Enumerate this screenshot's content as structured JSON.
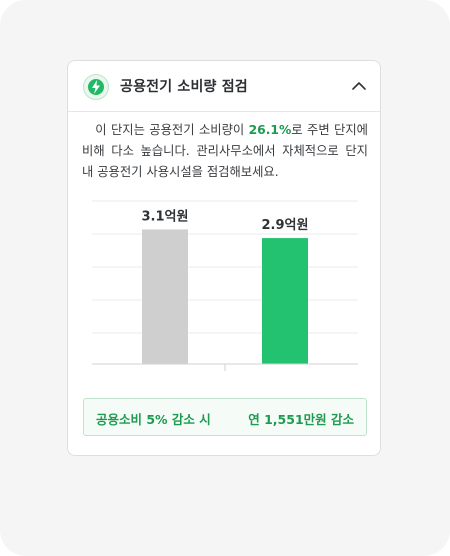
{
  "card": {
    "title": "공용전기 소비량 점검",
    "icon": "lightning-icon",
    "collapse_icon": "chevron-up-icon"
  },
  "description": {
    "before": "이 단지는 공용전기 소비량이 ",
    "highlight": "26.1%",
    "after": "로 주변 단지에 비해 다소 높습니다. 관리사무소에서 자체적으로 단지 내 공용전기 사용시설을 점검해보세요."
  },
  "chart_data": {
    "type": "bar",
    "categories": [
      "",
      ""
    ],
    "values": [
      3.1,
      2.9
    ],
    "labels": [
      "3.1억원",
      "2.9억원"
    ],
    "colors": [
      "#cfcfcf",
      "#22c270"
    ],
    "ylim": [
      0,
      3.8
    ],
    "grid": true
  },
  "summary": {
    "left": "공용소비 5% 감소 시",
    "right": "연 1,551만원 감소"
  },
  "colors": {
    "accent": "#22c270",
    "accent_text": "#1f9a50",
    "neutral_bar": "#cfcfcf"
  }
}
